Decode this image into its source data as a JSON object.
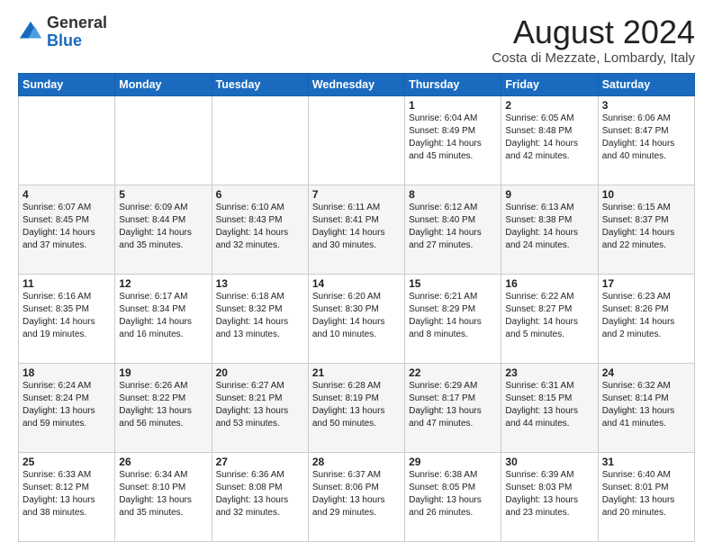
{
  "header": {
    "logo_line1": "General",
    "logo_line2": "Blue",
    "main_title": "August 2024",
    "subtitle": "Costa di Mezzate, Lombardy, Italy"
  },
  "days_of_week": [
    "Sunday",
    "Monday",
    "Tuesday",
    "Wednesday",
    "Thursday",
    "Friday",
    "Saturday"
  ],
  "weeks": [
    [
      {
        "day": "",
        "info": ""
      },
      {
        "day": "",
        "info": ""
      },
      {
        "day": "",
        "info": ""
      },
      {
        "day": "",
        "info": ""
      },
      {
        "day": "1",
        "info": "Sunrise: 6:04 AM\nSunset: 8:49 PM\nDaylight: 14 hours and 45 minutes."
      },
      {
        "day": "2",
        "info": "Sunrise: 6:05 AM\nSunset: 8:48 PM\nDaylight: 14 hours and 42 minutes."
      },
      {
        "day": "3",
        "info": "Sunrise: 6:06 AM\nSunset: 8:47 PM\nDaylight: 14 hours and 40 minutes."
      }
    ],
    [
      {
        "day": "4",
        "info": "Sunrise: 6:07 AM\nSunset: 8:45 PM\nDaylight: 14 hours and 37 minutes."
      },
      {
        "day": "5",
        "info": "Sunrise: 6:09 AM\nSunset: 8:44 PM\nDaylight: 14 hours and 35 minutes."
      },
      {
        "day": "6",
        "info": "Sunrise: 6:10 AM\nSunset: 8:43 PM\nDaylight: 14 hours and 32 minutes."
      },
      {
        "day": "7",
        "info": "Sunrise: 6:11 AM\nSunset: 8:41 PM\nDaylight: 14 hours and 30 minutes."
      },
      {
        "day": "8",
        "info": "Sunrise: 6:12 AM\nSunset: 8:40 PM\nDaylight: 14 hours and 27 minutes."
      },
      {
        "day": "9",
        "info": "Sunrise: 6:13 AM\nSunset: 8:38 PM\nDaylight: 14 hours and 24 minutes."
      },
      {
        "day": "10",
        "info": "Sunrise: 6:15 AM\nSunset: 8:37 PM\nDaylight: 14 hours and 22 minutes."
      }
    ],
    [
      {
        "day": "11",
        "info": "Sunrise: 6:16 AM\nSunset: 8:35 PM\nDaylight: 14 hours and 19 minutes."
      },
      {
        "day": "12",
        "info": "Sunrise: 6:17 AM\nSunset: 8:34 PM\nDaylight: 14 hours and 16 minutes."
      },
      {
        "day": "13",
        "info": "Sunrise: 6:18 AM\nSunset: 8:32 PM\nDaylight: 14 hours and 13 minutes."
      },
      {
        "day": "14",
        "info": "Sunrise: 6:20 AM\nSunset: 8:30 PM\nDaylight: 14 hours and 10 minutes."
      },
      {
        "day": "15",
        "info": "Sunrise: 6:21 AM\nSunset: 8:29 PM\nDaylight: 14 hours and 8 minutes."
      },
      {
        "day": "16",
        "info": "Sunrise: 6:22 AM\nSunset: 8:27 PM\nDaylight: 14 hours and 5 minutes."
      },
      {
        "day": "17",
        "info": "Sunrise: 6:23 AM\nSunset: 8:26 PM\nDaylight: 14 hours and 2 minutes."
      }
    ],
    [
      {
        "day": "18",
        "info": "Sunrise: 6:24 AM\nSunset: 8:24 PM\nDaylight: 13 hours and 59 minutes."
      },
      {
        "day": "19",
        "info": "Sunrise: 6:26 AM\nSunset: 8:22 PM\nDaylight: 13 hours and 56 minutes."
      },
      {
        "day": "20",
        "info": "Sunrise: 6:27 AM\nSunset: 8:21 PM\nDaylight: 13 hours and 53 minutes."
      },
      {
        "day": "21",
        "info": "Sunrise: 6:28 AM\nSunset: 8:19 PM\nDaylight: 13 hours and 50 minutes."
      },
      {
        "day": "22",
        "info": "Sunrise: 6:29 AM\nSunset: 8:17 PM\nDaylight: 13 hours and 47 minutes."
      },
      {
        "day": "23",
        "info": "Sunrise: 6:31 AM\nSunset: 8:15 PM\nDaylight: 13 hours and 44 minutes."
      },
      {
        "day": "24",
        "info": "Sunrise: 6:32 AM\nSunset: 8:14 PM\nDaylight: 13 hours and 41 minutes."
      }
    ],
    [
      {
        "day": "25",
        "info": "Sunrise: 6:33 AM\nSunset: 8:12 PM\nDaylight: 13 hours and 38 minutes."
      },
      {
        "day": "26",
        "info": "Sunrise: 6:34 AM\nSunset: 8:10 PM\nDaylight: 13 hours and 35 minutes."
      },
      {
        "day": "27",
        "info": "Sunrise: 6:36 AM\nSunset: 8:08 PM\nDaylight: 13 hours and 32 minutes."
      },
      {
        "day": "28",
        "info": "Sunrise: 6:37 AM\nSunset: 8:06 PM\nDaylight: 13 hours and 29 minutes."
      },
      {
        "day": "29",
        "info": "Sunrise: 6:38 AM\nSunset: 8:05 PM\nDaylight: 13 hours and 26 minutes."
      },
      {
        "day": "30",
        "info": "Sunrise: 6:39 AM\nSunset: 8:03 PM\nDaylight: 13 hours and 23 minutes."
      },
      {
        "day": "31",
        "info": "Sunrise: 6:40 AM\nSunset: 8:01 PM\nDaylight: 13 hours and 20 minutes."
      }
    ]
  ]
}
